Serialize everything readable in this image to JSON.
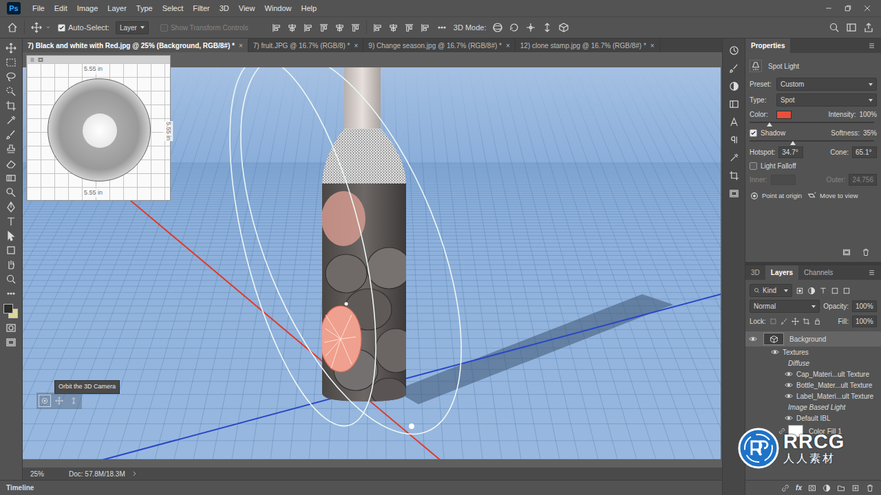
{
  "app": {
    "logo": "Ps"
  },
  "menu": [
    "File",
    "Edit",
    "Image",
    "Layer",
    "Type",
    "Select",
    "Filter",
    "3D",
    "View",
    "Window",
    "Help"
  ],
  "options_bar": {
    "auto_select": {
      "label": "Auto-Select:",
      "checked": true
    },
    "target": "Layer",
    "transform_controls": {
      "label": "Show Transform Controls",
      "checked": false,
      "disabled": true
    },
    "mode_label": "3D Mode:"
  },
  "tabs": [
    {
      "label": "7) Black and white with Red.jpg @ 25% (Background, RGB/8#) *",
      "close": "×",
      "selected": true
    },
    {
      "label": "7) fruit.JPG @ 16.7% (RGB/8) *",
      "close": "×",
      "selected": false
    },
    {
      "label": "9) Change season.jpg @ 16.7% (RGB/8#) *",
      "close": "×",
      "selected": false
    },
    {
      "label": "12) clone stamp.jpg @ 16.7% (RGB/8#) *",
      "close": "×",
      "selected": false
    }
  ],
  "viewport": {
    "tooltip": "Orbit the 3D Camera",
    "ground_plane_labels": [
      "5.55 in",
      "5.55 in",
      "5.55 in"
    ]
  },
  "status_bar": {
    "zoom": "25%",
    "doc": "Doc: 57.8M/18.3M"
  },
  "timeline": "Timeline",
  "properties": {
    "tab": "Properties",
    "kind_label": "Spot Light",
    "preset": {
      "label": "Preset:",
      "value": "Custom"
    },
    "type": {
      "label": "Type:",
      "value": "Spot"
    },
    "color": {
      "label": "Color:",
      "value": "#e8503c"
    },
    "intensity": {
      "label": "Intensity:",
      "value": "100%",
      "level": 0.16
    },
    "shadow": {
      "label": "Shadow",
      "checked": true
    },
    "softness": {
      "label": "Softness:",
      "value": "35%",
      "level": 0.35
    },
    "hotspot": {
      "label": "Hotspot:",
      "value": "34.7°"
    },
    "cone": {
      "label": "Cone:",
      "value": "65.1°"
    },
    "light_falloff": {
      "label": "Light Falloff",
      "checked": false
    },
    "inner": {
      "label": "Inner:",
      "disabled": true
    },
    "outer": {
      "label": "Outer:",
      "value": "24.756",
      "disabled": true
    },
    "actions": [
      "Point at origin",
      "Move to view"
    ]
  },
  "layers_panel": {
    "tabs": [
      {
        "label": "3D",
        "selected": false
      },
      {
        "label": "Layers",
        "selected": true
      },
      {
        "label": "Channels",
        "selected": false
      }
    ],
    "filter": "Kind",
    "blend": "Normal",
    "opacity": {
      "label": "Opacity:",
      "value": "100%"
    },
    "lock_label": "Lock:",
    "fill": {
      "label": "Fill:",
      "value": "100%"
    },
    "items": [
      {
        "kind": "layer",
        "label": "Background",
        "visible": true,
        "selected": true
      },
      {
        "kind": "group",
        "label": "Textures",
        "visible": true,
        "selected": false
      },
      {
        "kind": "heading",
        "label": "Diffuse",
        "visible": false,
        "selected": false
      },
      {
        "kind": "texture",
        "label": "Cap_Materi...ult Texture",
        "visible": true,
        "selected": false
      },
      {
        "kind": "texture",
        "label": "Bottle_Mater...ult Texture",
        "visible": true,
        "selected": false
      },
      {
        "kind": "texture",
        "label": "Label_Materi...ult Texture",
        "visible": true,
        "selected": false
      },
      {
        "kind": "heading",
        "label": "Image Based Light",
        "visible": false,
        "selected": false
      },
      {
        "kind": "texture",
        "label": "Default IBL",
        "visible": true,
        "selected": false
      },
      {
        "kind": "fill",
        "label": "Color Fill 1",
        "visible": true,
        "selected": false
      }
    ],
    "fx": "fx"
  },
  "watermark": {
    "brand": "RRCG",
    "sub": "人人素材"
  }
}
